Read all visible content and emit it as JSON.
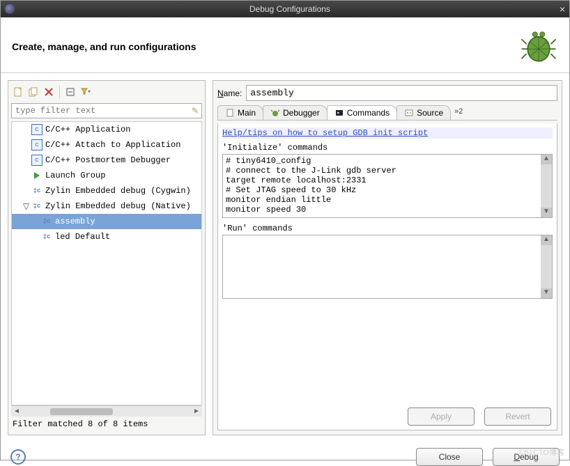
{
  "window": {
    "title": "Debug Configurations",
    "close": "×"
  },
  "header": {
    "title": "Create, manage, and run configurations"
  },
  "left": {
    "filter_placeholder": "type filter text",
    "tree": [
      {
        "icon": "c",
        "label": "C/C++ Application"
      },
      {
        "icon": "c",
        "label": "C/C++ Attach to Application"
      },
      {
        "icon": "c",
        "label": "C/C++ Postmortem Debugger"
      },
      {
        "icon": "play",
        "label": "Launch Group"
      },
      {
        "icon": "z",
        "label": "Zylin Embedded debug (Cygwin)"
      },
      {
        "icon": "z",
        "label": "Zylin Embedded debug (Native)",
        "expanded": true,
        "children": [
          {
            "icon": "z",
            "label": "assembly",
            "selected": true
          },
          {
            "icon": "z",
            "label": "led Default"
          }
        ]
      }
    ],
    "status": "Filter matched 8 of 8 items"
  },
  "right": {
    "name_label": "Name:",
    "name_value": "assembly",
    "tabs": [
      {
        "label": "Main",
        "icon": "doc"
      },
      {
        "label": "Debugger",
        "icon": "bug"
      },
      {
        "label": "Commands",
        "icon": "term",
        "active": true
      },
      {
        "label": "Source",
        "icon": "src"
      }
    ],
    "overflow": "»2",
    "help_link": "Help/tips on how to setup GDB init script",
    "init_label": "'Initialize' commands",
    "init_text": "# tiny6410_config\n# connect to the J-Link gdb server\ntarget remote localhost:2331\n# Set JTAG speed to 30 kHz\nmonitor endian little\nmonitor speed 30",
    "run_label": "'Run' commands",
    "run_text": "",
    "apply": "Apply",
    "revert": "Revert"
  },
  "footer": {
    "close": "Close",
    "debug": "Debug"
  },
  "watermark": "©51CTO博客"
}
